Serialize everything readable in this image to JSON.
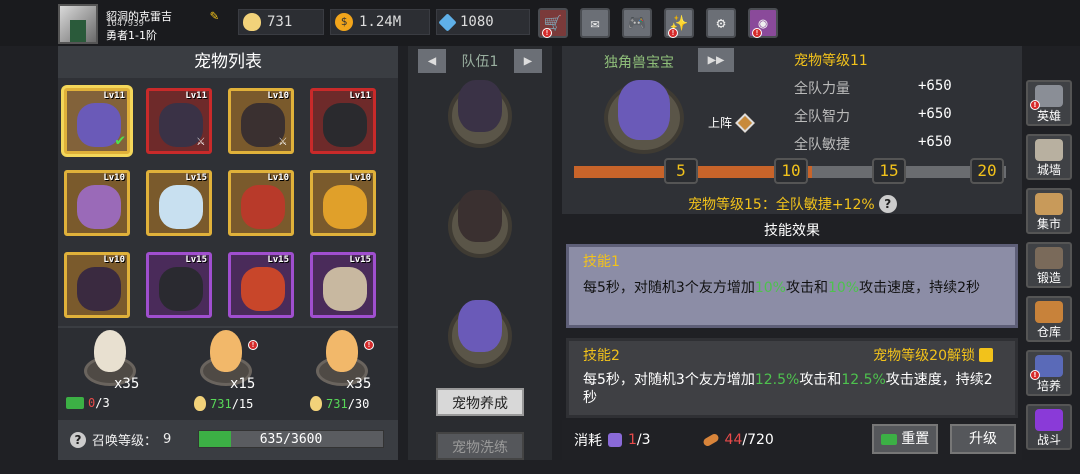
{
  "player": {
    "name": "貂洞的克雷吉",
    "id": "1647939",
    "rank": "勇者1-1阶"
  },
  "currencies": [
    {
      "name": "egg",
      "icon": "egg-icon",
      "value": "731",
      "color": "#f2d27a"
    },
    {
      "name": "gold",
      "icon": "gold-coin-icon",
      "value": "1.24M",
      "color": "#f2a51b"
    },
    {
      "name": "gem",
      "icon": "gem-icon",
      "value": "1080",
      "color": "#5fb0e8"
    }
  ],
  "toolbar": [
    {
      "icon": "shop-cart-icon",
      "badge": "!"
    },
    {
      "icon": "mail-icon"
    },
    {
      "icon": "gamepad-icon"
    },
    {
      "icon": "sparkle-icon",
      "badge": "!"
    },
    {
      "icon": "settings-gear-icon"
    },
    {
      "icon": "spin-wheel-icon",
      "badge": "!"
    }
  ],
  "pet_list": {
    "title": "宠物列表",
    "pets": [
      {
        "level": "Lv11",
        "rarity": "gold",
        "selected": true,
        "mark": "check",
        "color": "#6a5ab8"
      },
      {
        "level": "Lv11",
        "rarity": "red",
        "mark": "x",
        "color": "#3a3246"
      },
      {
        "level": "Lv10",
        "rarity": "gold",
        "mark": "x",
        "color": "#3a3030"
      },
      {
        "level": "Lv11",
        "rarity": "red",
        "color": "#2a2a2e"
      },
      {
        "level": "Lv10",
        "rarity": "gold",
        "color": "#9a6ab8"
      },
      {
        "level": "Lv15",
        "rarity": "gold",
        "color": "#c8e0f0"
      },
      {
        "level": "Lv10",
        "rarity": "gold",
        "color": "#b83a2a"
      },
      {
        "level": "Lv10",
        "rarity": "gold",
        "color": "#e0a02a"
      },
      {
        "level": "Lv10",
        "rarity": "gold",
        "color": "#3a2a40"
      },
      {
        "level": "Lv15",
        "rarity": "purple",
        "color": "#2a2a30"
      },
      {
        "level": "Lv15",
        "rarity": "purple",
        "color": "#c8462a"
      },
      {
        "level": "Lv15",
        "rarity": "purple",
        "color": "#c8b8a0"
      }
    ]
  },
  "eggs": [
    {
      "count": "x35",
      "cost_current": "0",
      "cost_total": "/3",
      "cost_icon": "ad-video-icon",
      "color": "#e8e0d0",
      "cost_short": true
    },
    {
      "count": "x15",
      "cost_current": "731",
      "cost_total": "/15",
      "cost_icon": "egg-icon",
      "color": "#f2b86a",
      "badge": "!"
    },
    {
      "count": "x35",
      "cost_current": "731",
      "cost_total": "/30",
      "cost_icon": "egg-icon",
      "color": "#f2b86a",
      "badge": "!"
    }
  ],
  "summon": {
    "label": "召唤等级：",
    "level": "9",
    "progress_text": "635/3600",
    "progress_fraction": 0.176
  },
  "team": {
    "label": "队伍1",
    "slots": [
      {
        "color": "#3a3246"
      },
      {
        "color": "#3a3030"
      },
      {
        "color": "#6a5ab8"
      }
    ],
    "train_button": "宠物养成",
    "wash_button": "宠物洗练"
  },
  "detail": {
    "pet_name": "独角兽宝宝",
    "pet_level": "宠物等级11",
    "deploy_label": "上阵",
    "pet_color": "#6a5ab8",
    "stats": [
      {
        "label": "全队力量",
        "value": "+650"
      },
      {
        "label": "全队智力",
        "value": "+650"
      },
      {
        "label": "全队敏捷",
        "value": "+650"
      }
    ],
    "milestones": [
      "5",
      "10",
      "15",
      "20"
    ],
    "progress_fraction": 0.55,
    "bonus_text": "宠物等级15：全队敏捷+12%",
    "skills_title": "技能效果",
    "skill1": {
      "name": "技能1",
      "desc_pre": "每5秒，对随机3个友方增加",
      "v1": "10%",
      "desc_mid": "攻击和",
      "v2": "10%",
      "desc_post": "攻击速度，持续2秒"
    },
    "skill2": {
      "name": "技能2",
      "unlock": "宠物等级20解锁",
      "desc_pre": "每5秒，对随机3个友方增加",
      "v1": "12.5%",
      "desc_mid": "攻击和",
      "v2": "12.5%",
      "desc_post": "攻击速度，持续2秒"
    },
    "consume_label": "消耗",
    "consume_shards_cur": "1",
    "consume_shards_total": "/3",
    "consume_bones_cur": "44",
    "consume_bones_total": "/720",
    "reset_button": "重置",
    "upgrade_button": "升级"
  },
  "sidenav": [
    {
      "label": "英雄",
      "icon": "helmet-icon",
      "color": "#8a8e96",
      "badge": "!"
    },
    {
      "label": "城墙",
      "icon": "castle-wall-icon",
      "color": "#b8b0a0"
    },
    {
      "label": "集市",
      "icon": "market-icon",
      "color": "#c89a5a"
    },
    {
      "label": "锻造",
      "icon": "anvil-icon",
      "color": "#7a6a5a"
    },
    {
      "label": "仓库",
      "icon": "chest-icon",
      "color": "#c8823a"
    },
    {
      "label": "培养",
      "icon": "shrine-icon",
      "color": "#5a6ab8",
      "badge": "!"
    },
    {
      "label": "战斗",
      "icon": "battle-portal-icon",
      "color": "#8a3ad8"
    }
  ]
}
